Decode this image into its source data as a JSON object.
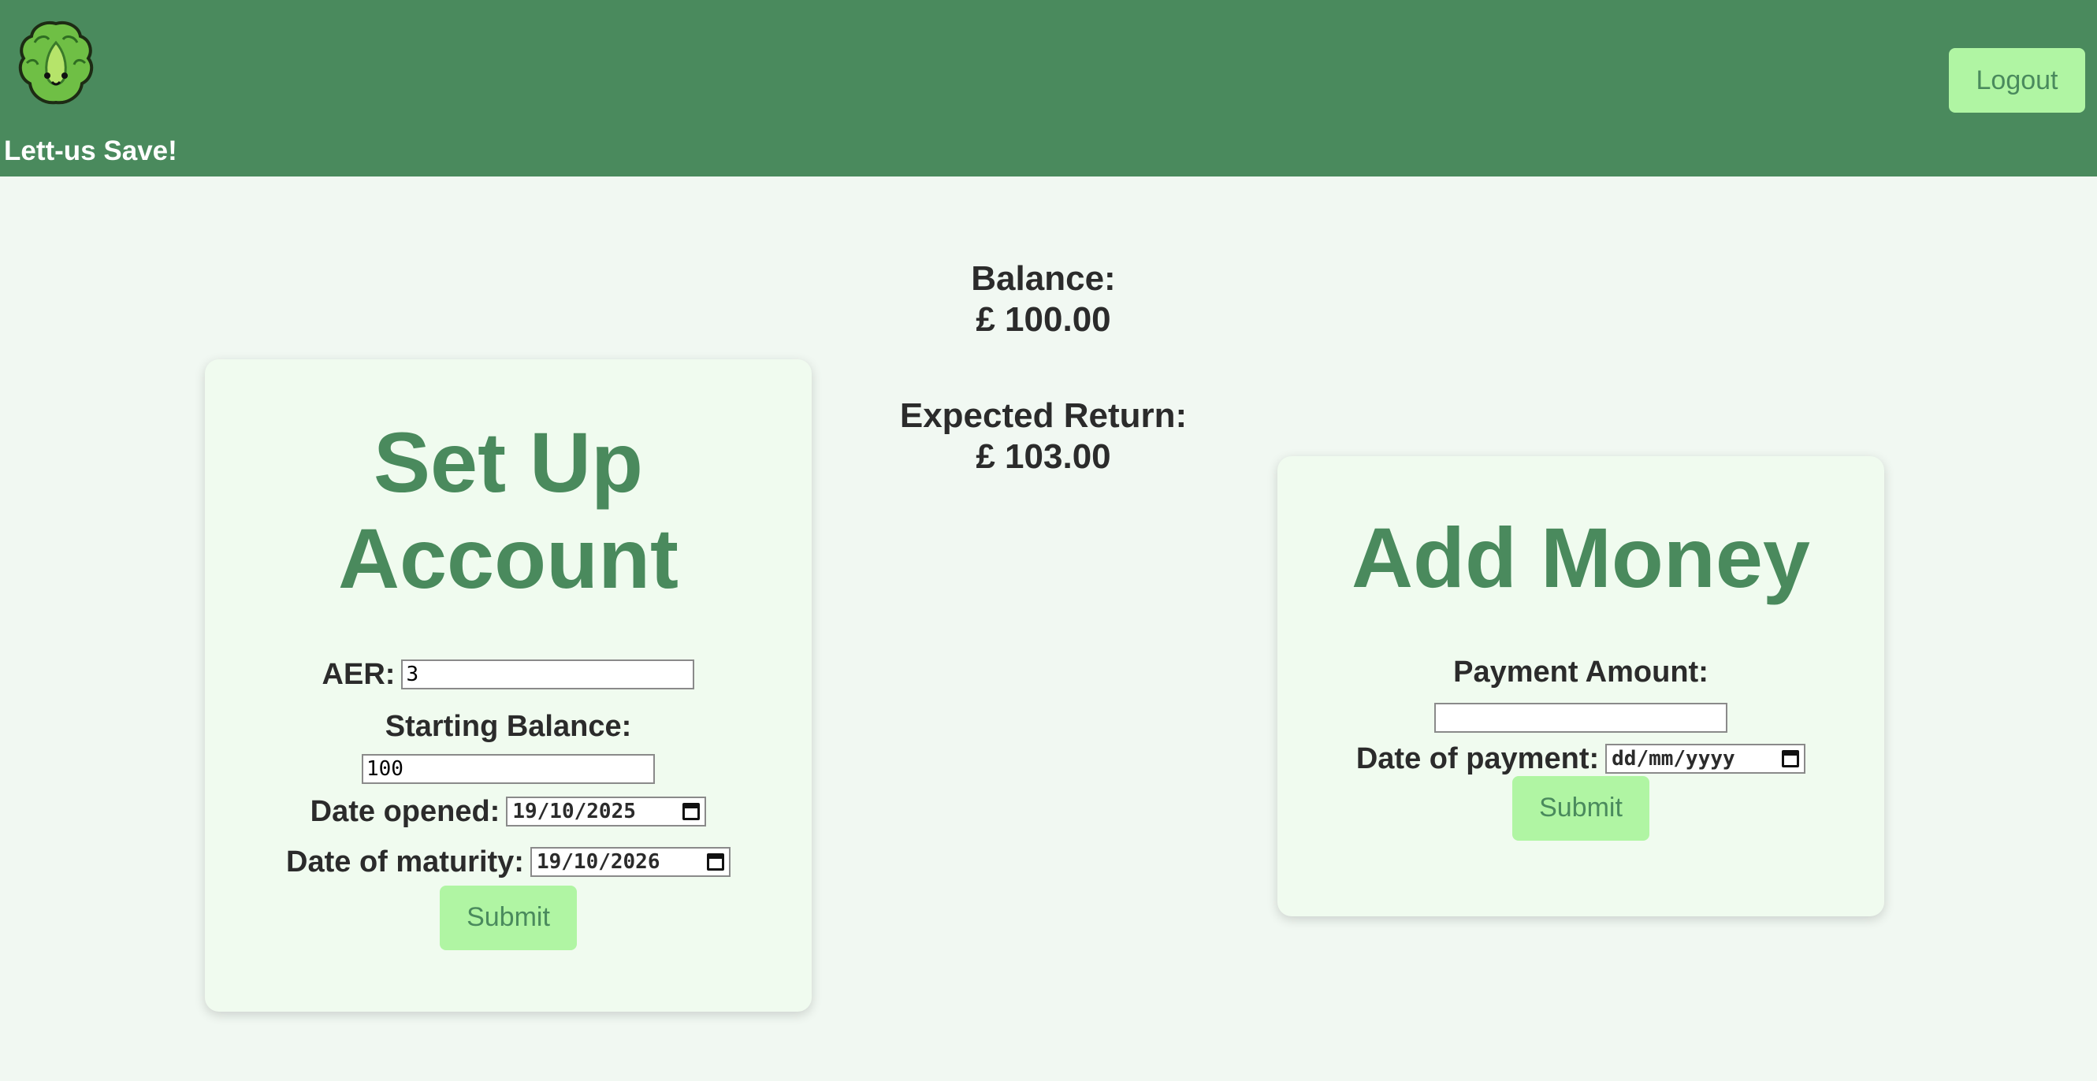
{
  "header": {
    "brand": "Lett-us Save!",
    "logo_icon": "lettuce-mascot-icon",
    "logout_label": "Logout"
  },
  "summary": {
    "balance_label": "Balance:",
    "balance_value": "£ 100.00",
    "expected_label": "Expected Return:",
    "expected_value": "£ 103.00"
  },
  "setup": {
    "title": "Set Up Account",
    "aer_label": "AER:",
    "aer_value": "3",
    "starting_balance_label": "Starting Balance:",
    "starting_balance_value": "100",
    "date_opened_label": "Date opened:",
    "date_opened_value": "19/10/2025",
    "date_maturity_label": "Date of maturity:",
    "date_maturity_value": "19/10/2026",
    "submit_label": "Submit"
  },
  "add_money": {
    "title": "Add Money",
    "payment_amount_label": "Payment Amount:",
    "payment_amount_value": "",
    "date_payment_label": "Date of payment:",
    "date_payment_placeholder": "dd/mm/yyyy",
    "submit_label": "Submit"
  },
  "colors": {
    "header_bg": "#4a8a5d",
    "page_bg": "#f1f8f2",
    "card_bg": "#f0fbef",
    "button_bg": "#b0f5a3",
    "accent_text": "#4a8a5d"
  }
}
